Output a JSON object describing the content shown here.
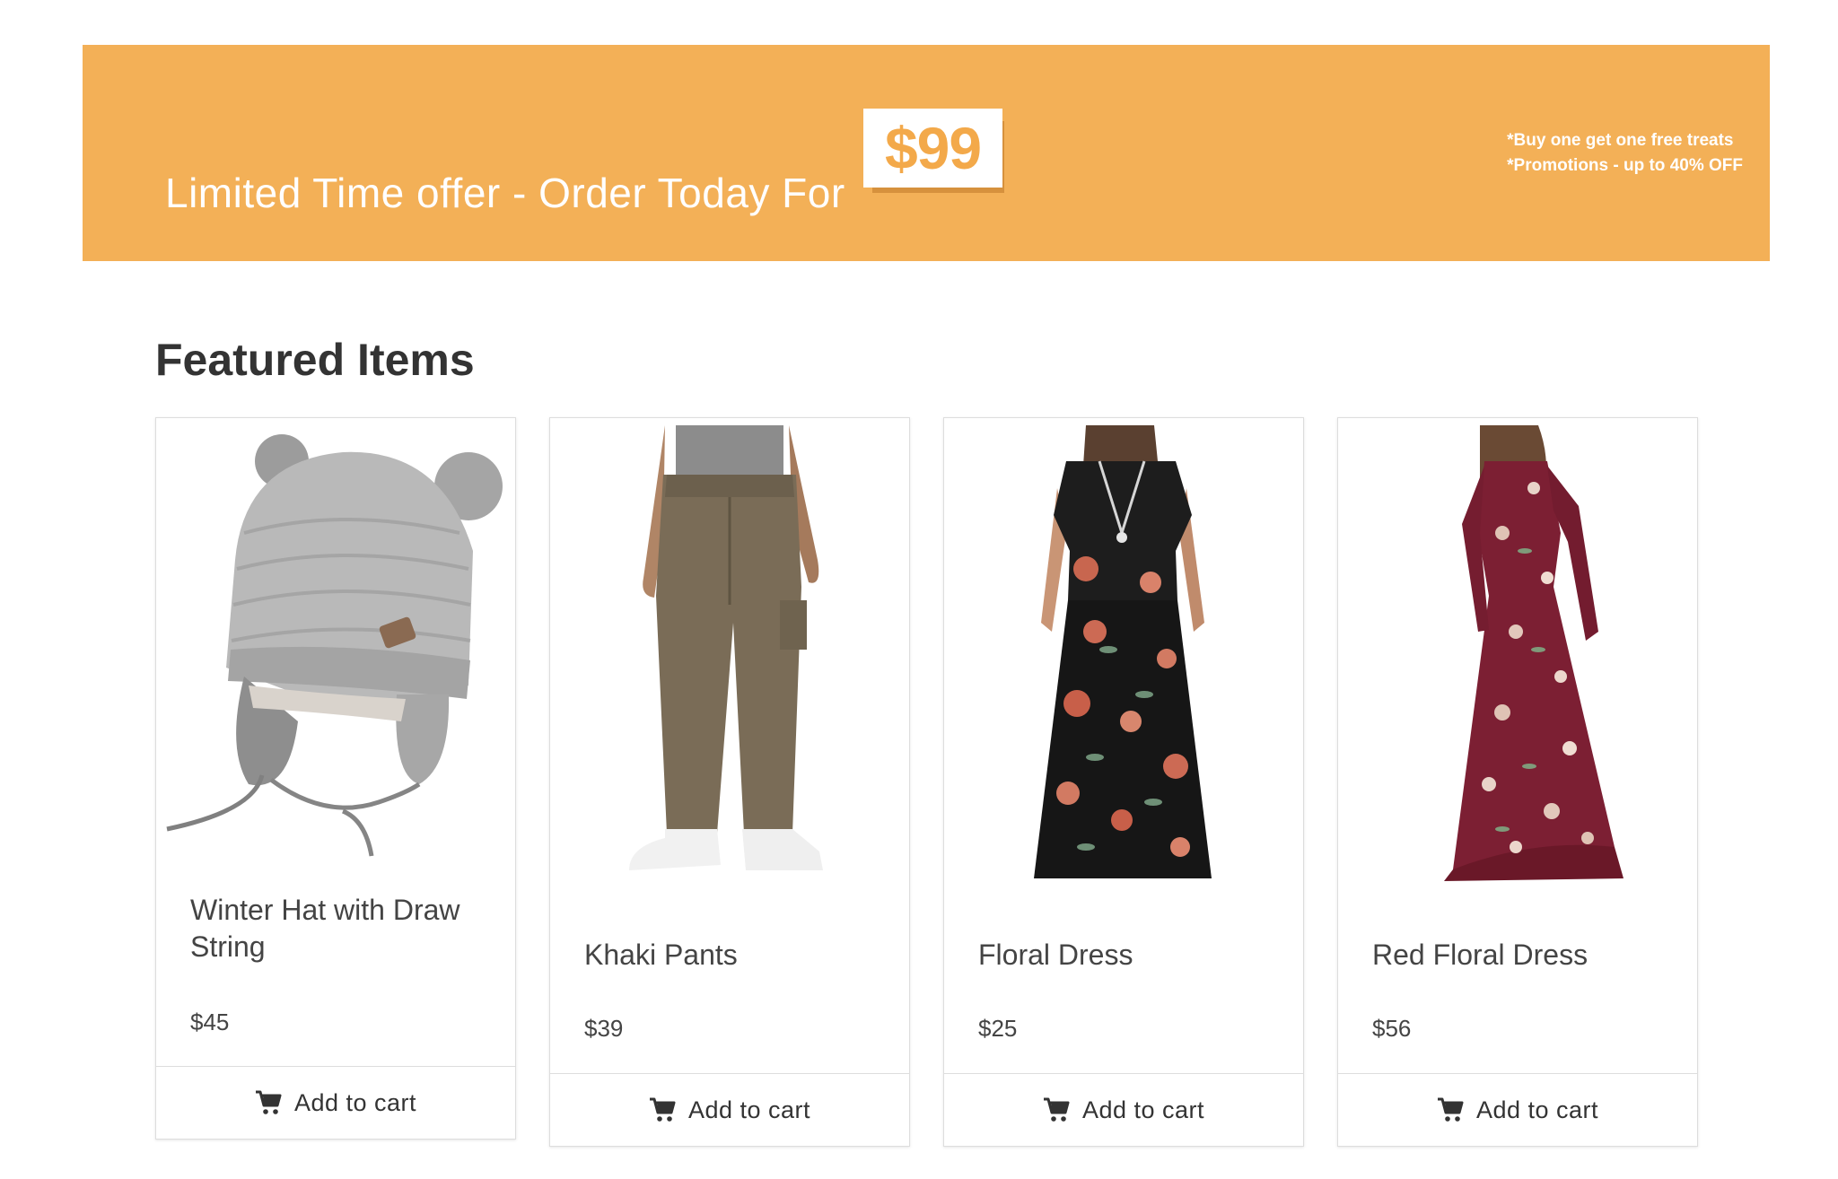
{
  "banner": {
    "headline": "Limited Time offer - Order Today For",
    "price": "$99",
    "notes": [
      "*Buy one get one free treats",
      "*Promotions - up to 40% OFF"
    ],
    "background": "#f3b057",
    "price_color": "#f3a94a"
  },
  "featured": {
    "title": "Featured Items",
    "products": [
      {
        "name": "Winter Hat with Draw String",
        "price": "$45",
        "button": "Add to cart",
        "image": "knit-hat-image"
      },
      {
        "name": "Khaki Pants",
        "price": "$39",
        "button": "Add to cart",
        "image": "khaki-pants-image"
      },
      {
        "name": "Floral Dress",
        "price": "$25",
        "button": "Add to cart",
        "image": "black-floral-dress-image"
      },
      {
        "name": "Red Floral Dress",
        "price": "$56",
        "button": "Add to cart",
        "image": "red-floral-dress-image"
      }
    ]
  },
  "icons": {
    "cart": "shopping-cart-icon"
  }
}
